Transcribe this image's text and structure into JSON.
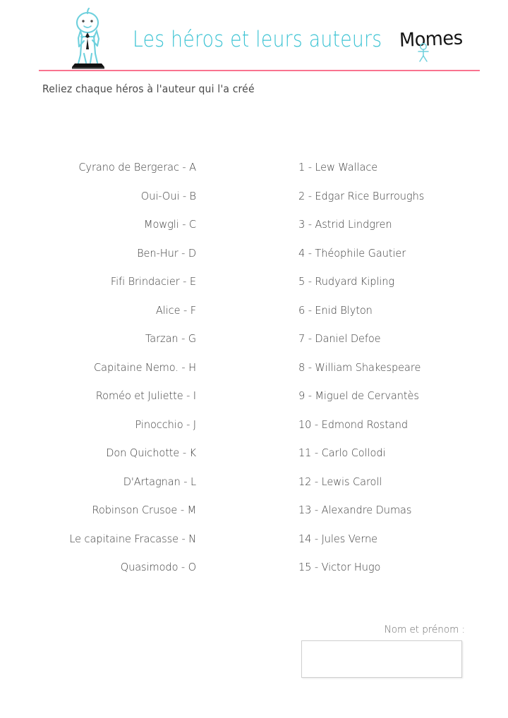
{
  "header": {
    "title": "Les héros et leurs auteurs",
    "brand": "Momes",
    "mascot_icon": "boy-on-book-icon",
    "brand_figure_icon": "little-person-icon",
    "rule_color": "#f9738f",
    "title_color": "#3fc4d4"
  },
  "instruction": "Reliez chaque héros à l'auteur qui l'a créé",
  "columns": {
    "heroes": [
      "Cyrano de Bergerac - A",
      "Oui-Oui - B",
      "Mowgli - C",
      "Ben-Hur - D",
      "Fifi Brindacier - E",
      "Alice - F",
      "Tarzan - G",
      "Capitaine Nemo. - H",
      "Roméo et Juliette - I",
      "Pinocchio - J",
      "Don Quichotte - K",
      "D'Artagnan - L",
      "Robinson Crusoe - M",
      "Le capitaine Fracasse - N",
      "Quasimodo - O"
    ],
    "authors": [
      "1 - Lew Wallace",
      "2 - Edgar Rice Burroughs",
      "3 - Astrid Lindgren",
      "4 - Théophile Gautier",
      "5 - Rudyard Kipling",
      "6 - Enid Blyton",
      "7 - Daniel Defoe",
      "8 - William Shakespeare",
      "9 - Miguel de Cervantès",
      "10 - Edmond Rostand",
      "11 - Carlo Collodi",
      "12 - Lewis Caroll",
      "13 - Alexandre Dumas",
      "14 - Jules Verne",
      "15 - Victor Hugo"
    ]
  },
  "footer": {
    "name_label": "Nom et prénom :",
    "name_value": "",
    "name_placeholder": ""
  }
}
